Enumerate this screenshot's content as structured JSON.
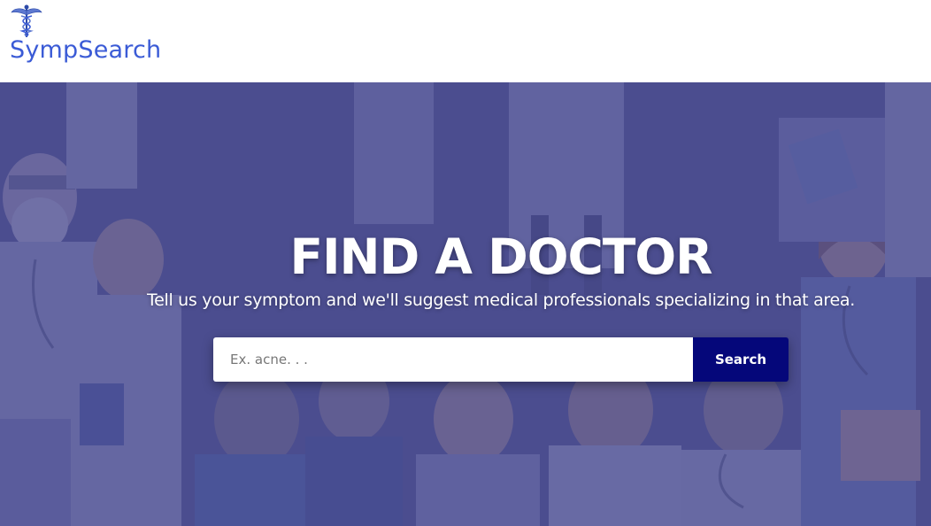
{
  "header": {
    "logo_text": "SympSearch",
    "logo_icon": "caduceus-icon"
  },
  "hero": {
    "title": "FIND A DOCTOR",
    "subtitle": "Tell us your symptom and we'll suggest medical professionals specializing in that area.",
    "background_image": "doctors-illustration"
  },
  "search": {
    "placeholder": "Ex. acne. . .",
    "value": "",
    "button_label": "Search"
  },
  "colors": {
    "brand": "#3b5bd6",
    "hero_bg": "#4c4f8c",
    "button": "#05077a"
  }
}
